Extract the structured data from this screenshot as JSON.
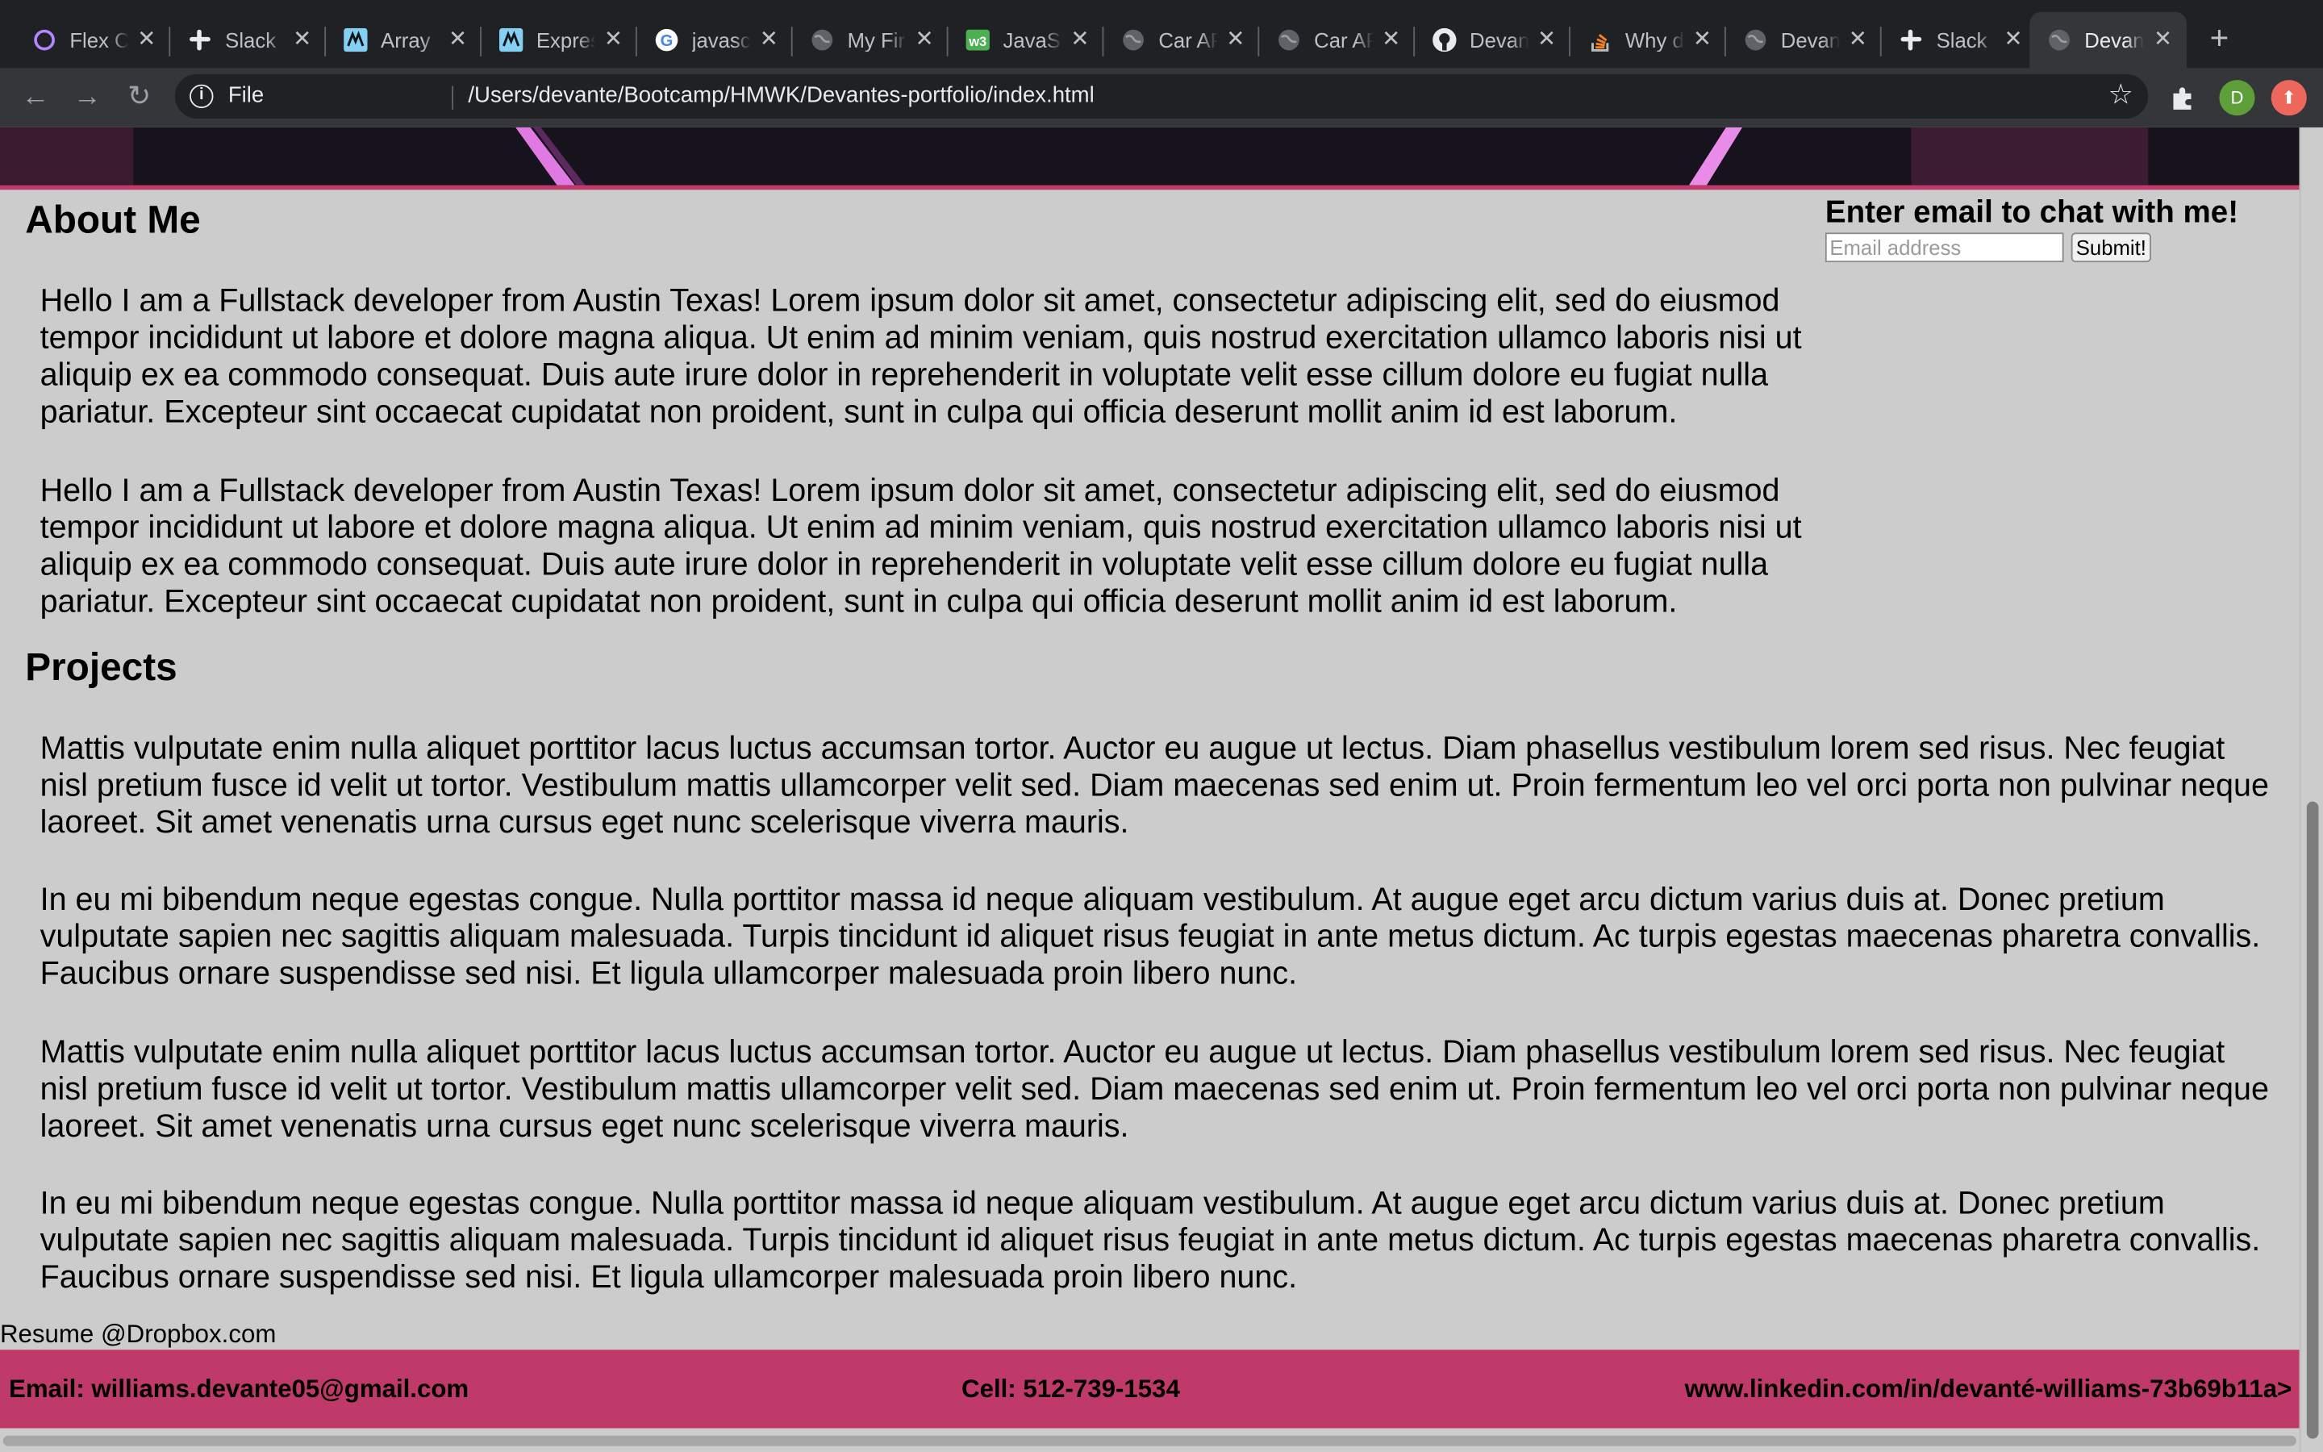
{
  "browser": {
    "tabs": [
      {
        "title": "Flex Cheatsheet",
        "icon": "circle-icon",
        "active": false
      },
      {
        "title": "Slack",
        "icon": "slack-icon",
        "active": false
      },
      {
        "title": "Array",
        "icon": "mdn-icon",
        "active": false
      },
      {
        "title": "Express",
        "icon": "mdn-icon",
        "active": false
      },
      {
        "title": "javascript",
        "icon": "google-icon",
        "active": false
      },
      {
        "title": "My First",
        "icon": "globe-icon",
        "active": false
      },
      {
        "title": "JavaScript",
        "icon": "w3schools-icon",
        "active": false
      },
      {
        "title": "Car API",
        "icon": "globe-icon",
        "active": false
      },
      {
        "title": "Car API",
        "icon": "globe-icon",
        "active": false
      },
      {
        "title": "Devante",
        "icon": "github-icon",
        "active": false
      },
      {
        "title": "Why do",
        "icon": "stackoverflow-icon",
        "active": false
      },
      {
        "title": "Devante",
        "icon": "globe-icon",
        "active": false
      },
      {
        "title": "Slack",
        "icon": "slack-icon",
        "active": false
      },
      {
        "title": "Devante",
        "icon": "globe-icon",
        "active": true
      }
    ],
    "address_scheme": "File",
    "address_url": "/Users/devante/Bootcamp/HMWK/Devantes-portfolio/index.html",
    "profile_initial": "D"
  },
  "page": {
    "about_heading": "About Me",
    "about_paragraphs": [
      "Hello I am a Fullstack developer from Austin Texas! Lorem ipsum dolor sit amet, consectetur adipiscing elit, sed do eiusmod tempor incididunt ut labore et dolore magna aliqua. Ut enim ad minim veniam, quis nostrud exercitation ullamco laboris nisi ut aliquip ex ea commodo consequat. Duis aute irure dolor in reprehenderit in voluptate velit esse cillum dolore eu fugiat nulla pariatur. Excepteur sint occaecat cupidatat non proident, sunt in culpa qui officia deserunt mollit anim id est laborum.",
      "Hello I am a Fullstack developer from Austin Texas! Lorem ipsum dolor sit amet, consectetur adipiscing elit, sed do eiusmod tempor incididunt ut labore et dolore magna aliqua. Ut enim ad minim veniam, quis nostrud exercitation ullamco laboris nisi ut aliquip ex ea commodo consequat. Duis aute irure dolor in reprehenderit in voluptate velit esse cillum dolore eu fugiat nulla pariatur. Excepteur sint occaecat cupidatat non proident, sunt in culpa qui officia deserunt mollit anim id est laborum."
    ],
    "chat": {
      "label": "Enter email to chat with me!",
      "placeholder": "Email address",
      "submit_label": "Submit!"
    },
    "projects_heading": "Projects",
    "project_paragraphs": [
      "Mattis vulputate enim nulla aliquet porttitor lacus luctus accumsan tortor. Auctor eu augue ut lectus. Diam phasellus vestibulum lorem sed risus. Nec feugiat nisl pretium fusce id velit ut tortor. Vestibulum mattis ullamcorper velit sed. Diam maecenas sed enim ut. Proin fermentum leo vel orci porta non pulvinar neque laoreet. Sit amet venenatis urna cursus eget nunc scelerisque viverra mauris.",
      "In eu mi bibendum neque egestas congue. Nulla porttitor massa id neque aliquam vestibulum. At augue eget arcu dictum varius duis at. Donec pretium vulputate sapien nec sagittis aliquam malesuada. Turpis tincidunt id aliquet risus feugiat in ante metus dictum. Ac turpis egestas maecenas pharetra convallis. Faucibus ornare suspendisse sed nisi. Et ligula ullamcorper malesuada proin libero nunc.",
      "Mattis vulputate enim nulla aliquet porttitor lacus luctus accumsan tortor. Auctor eu augue ut lectus. Diam phasellus vestibulum lorem sed risus. Nec feugiat nisl pretium fusce id velit ut tortor. Vestibulum mattis ullamcorper velit sed. Diam maecenas sed enim ut. Proin fermentum leo vel orci porta non pulvinar neque laoreet. Sit amet venenatis urna cursus eget nunc scelerisque viverra mauris.",
      "In eu mi bibendum neque egestas congue. Nulla porttitor massa id neque aliquam vestibulum. At augue eget arcu dictum varius duis at. Donec pretium vulputate sapien nec sagittis aliquam malesuada. Turpis tincidunt id aliquet risus feugiat in ante metus dictum. Ac turpis egestas maecenas pharetra convallis. Faucibus ornare suspendisse sed nisi. Et ligula ullamcorper malesuada proin libero nunc."
    ],
    "resume_link": "Resume @Dropbox.com",
    "footer": {
      "email": "Email: williams.devante05@gmail.com",
      "cell": "Cell: 512-739-1534",
      "linkedin": "www.linkedin.com/in/devanté-williams-73b69b11a>"
    }
  },
  "colors": {
    "page_background": "#cccccc",
    "accent_pink": "#bf3a68",
    "browser_chrome": "#202124"
  }
}
